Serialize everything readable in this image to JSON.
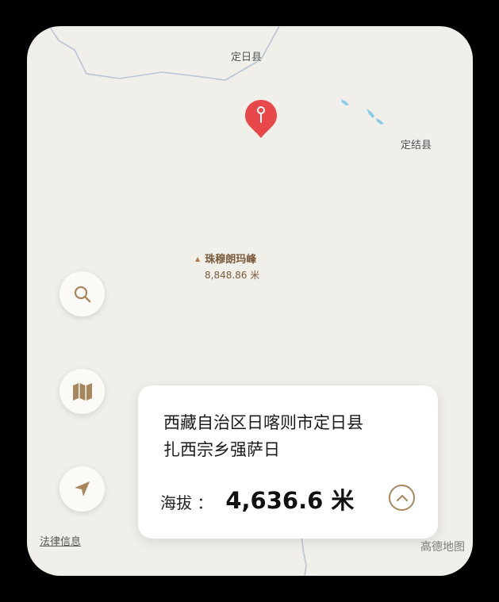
{
  "map": {
    "cities": [
      {
        "name": "定日县"
      },
      {
        "name": "定结县"
      }
    ],
    "peak": {
      "name": "珠穆朗玛峰",
      "elevation": "8,848.86 米"
    }
  },
  "controls": {
    "search_icon": "search-icon",
    "map_icon": "map-icon",
    "locate_icon": "navigation-arrow-icon"
  },
  "footer": {
    "legal": "法律信息",
    "brand": "高德地图"
  },
  "card": {
    "address_line1": "西藏自治区日喀则市定日县",
    "address_line2": "扎西宗乡强萨日",
    "altitude_label": "海拔 ：",
    "altitude_value": "4,636.6 米",
    "expand_icon": "chevron-up-icon"
  },
  "colors": {
    "accent": "#a8875e",
    "pin": "#e8484a",
    "map_bg": "#f0efe9"
  }
}
